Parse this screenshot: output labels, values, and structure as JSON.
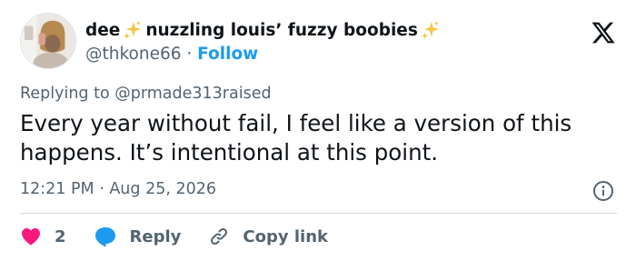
{
  "user": {
    "name_part1": "dee",
    "name_part2": "nuzzling louis’ fuzzy boobies",
    "handle": "@thkone66",
    "separator": "·",
    "follow_label": "Follow"
  },
  "reply_context": {
    "prefix": "Replying to",
    "mention": "@prmade313raised"
  },
  "tweet": {
    "text": "Every year without fail, I feel like a version of this happens. It’s intentional at this point.",
    "timestamp": "12:21 PM · Aug 25, 2026"
  },
  "actions": {
    "like_count": "2",
    "reply_label": "Reply",
    "copy_link_label": "Copy link"
  },
  "colors": {
    "text": "#0f1419",
    "secondary": "#536471",
    "link": "#1d9bf0",
    "heart": "#f91880",
    "reply_bubble": "#1d9bf0",
    "sparkle": "#f4c542"
  },
  "icons": [
    "avatar",
    "sparkles-icon",
    "x-logo-icon",
    "info-icon",
    "heart-icon",
    "reply-bubble-icon",
    "link-icon"
  ]
}
